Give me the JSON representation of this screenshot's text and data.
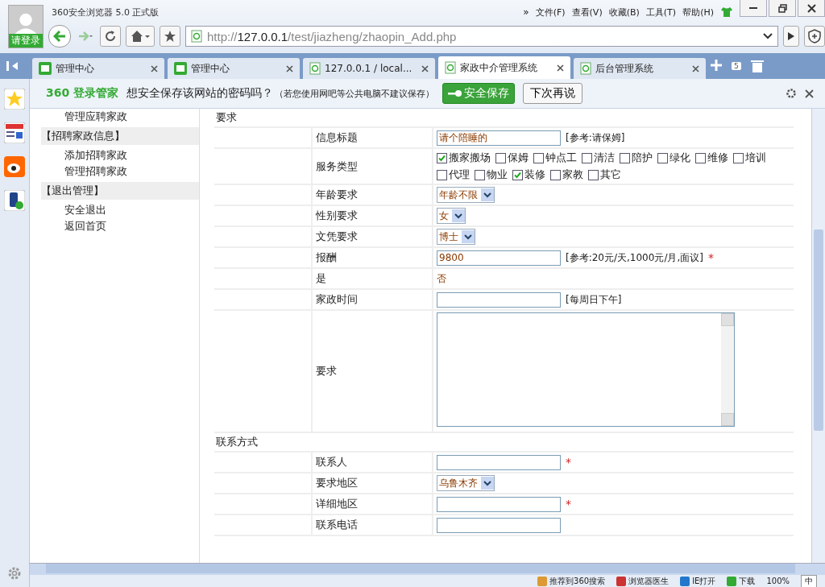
{
  "window": {
    "title": "360安全浏览器 5.0 正式版",
    "login": "请登录",
    "more": "»",
    "menu": [
      "文件(F)",
      "查看(V)",
      "收藏(B)",
      "工具(T)",
      "帮助(H)"
    ]
  },
  "address": {
    "host": "127.0.0.1",
    "prefix": "http://",
    "path": "/test/jiazheng/zhaopin_Add.php"
  },
  "tabs": [
    {
      "label": "管理中心",
      "kind": "logo",
      "selected": false
    },
    {
      "label": "管理中心",
      "kind": "logo",
      "selected": false
    },
    {
      "label": "127.0.0.1 / local...",
      "kind": "page",
      "selected": false
    },
    {
      "label": "家政中介管理系统",
      "kind": "page",
      "selected": true
    },
    {
      "label": "后台管理系统",
      "kind": "page",
      "selected": false
    }
  ],
  "tab_count": "5",
  "password_bar": {
    "brand": "360",
    "product": "登录管家",
    "question": "想安全保存该网站的密码吗？",
    "hint": "（若您使用网吧等公共电脑不建议保存）",
    "save": "安全保存",
    "later": "下次再说"
  },
  "sidebar": {
    "items": [
      {
        "label": "管理应聘家政",
        "kind": "link"
      },
      {
        "label": "【招聘家政信息】",
        "kind": "group"
      },
      {
        "label": "添加招聘家政",
        "kind": "link"
      },
      {
        "label": "管理招聘家政",
        "kind": "link"
      },
      {
        "label": "【退出管理】",
        "kind": "group"
      },
      {
        "label": "安全退出",
        "kind": "link"
      },
      {
        "label": "返回首页",
        "kind": "link"
      }
    ]
  },
  "form": {
    "section1": "要求",
    "rows": [
      {
        "label": "信息标题",
        "kind": "text",
        "value": "请个陪睡的",
        "note": "[参考:请保姆]"
      },
      {
        "label": "服务类型",
        "kind": "checks",
        "options": [
          {
            "label": "搬家搬场",
            "checked": true
          },
          {
            "label": "保姆",
            "checked": false
          },
          {
            "label": "钟点工",
            "checked": false
          },
          {
            "label": "清洁",
            "checked": false
          },
          {
            "label": "陪护",
            "checked": false
          },
          {
            "label": "绿化",
            "checked": false
          },
          {
            "label": "维修",
            "checked": false
          },
          {
            "label": "培训",
            "checked": false
          },
          {
            "label": "代理",
            "checked": false
          },
          {
            "label": "物业",
            "checked": false
          },
          {
            "label": "装修",
            "checked": true
          },
          {
            "label": "家教",
            "checked": false
          },
          {
            "label": "其它",
            "checked": false
          }
        ]
      },
      {
        "label": "年龄要求",
        "kind": "select",
        "value": "年龄不限"
      },
      {
        "label": "性别要求",
        "kind": "select",
        "value": "女"
      },
      {
        "label": "文凭要求",
        "kind": "select",
        "value": "博士"
      },
      {
        "label": "报酬",
        "kind": "text",
        "value": "9800",
        "note": "[参考:20元/天,1000元/月,面议]",
        "required_mark": "*"
      },
      {
        "label": "是",
        "kind": "plain",
        "value": "否"
      },
      {
        "label": "家政时间",
        "kind": "text",
        "note": "[每周日下午]"
      },
      {
        "label": "要求",
        "kind": "area"
      }
    ],
    "section2": "联系方式",
    "rows2": [
      {
        "label": "联系人",
        "kind": "text",
        "required_mark": "*"
      },
      {
        "label": "要求地区",
        "kind": "select",
        "value": "乌鲁木齐"
      },
      {
        "label": "详细地区",
        "kind": "text",
        "required_mark": "*"
      },
      {
        "label": "联系电话",
        "kind": "text"
      }
    ]
  },
  "status_bar": {
    "items": [
      "推荐到360搜索",
      "浏览器医生",
      "IE打开",
      "下载"
    ],
    "zoom": "100%",
    "ime": "中"
  }
}
